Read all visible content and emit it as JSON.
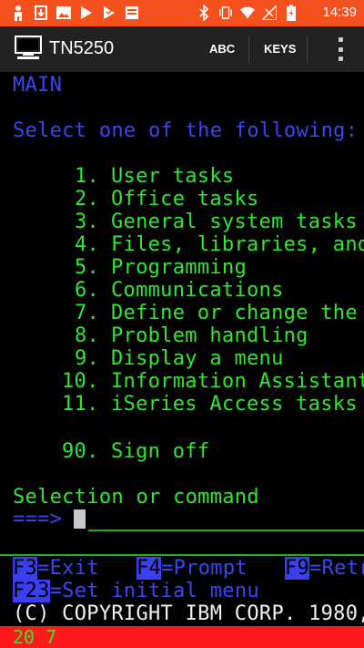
{
  "statusbar": {
    "time": "14:39",
    "notification_icons": [
      "person-icon",
      "download-icon",
      "image-icon",
      "play-store-icon",
      "play-store-icon",
      "news-icon"
    ],
    "system_icons": [
      "bluetooth-icon",
      "vibrate-icon",
      "wifi-icon",
      "no-signal-icon",
      "battery-charging-icon"
    ],
    "color": "#f4511e"
  },
  "appbar": {
    "title": "TN5250",
    "abc_label": "ABC",
    "keys_label": "KEYS",
    "more_icon": "more-vert-icon"
  },
  "terminal": {
    "screen_title": "MAIN",
    "prompt": "Select one of the following:",
    "menu_items": [
      {
        "num": "1.",
        "label": "User tasks"
      },
      {
        "num": "2.",
        "label": "Office tasks"
      },
      {
        "num": "3.",
        "label": "General system tasks"
      },
      {
        "num": "4.",
        "label": "Files, libraries, and"
      },
      {
        "num": "5.",
        "label": "Programming"
      },
      {
        "num": "6.",
        "label": "Communications"
      },
      {
        "num": "7.",
        "label": "Define or change the"
      },
      {
        "num": "8.",
        "label": "Problem handling"
      },
      {
        "num": "9.",
        "label": "Display a menu"
      },
      {
        "num": "10.",
        "label": "Information Assistant"
      },
      {
        "num": "11.",
        "label": "iSeries Access tasks"
      }
    ],
    "sign_off": {
      "num": "90.",
      "label": "Sign off"
    },
    "selection_label": "Selection or command",
    "input_arrow": "===>",
    "fkeys_row1": [
      {
        "key": "F3",
        "label": "=Exit"
      },
      {
        "key": "F4",
        "label": "=Prompt"
      },
      {
        "key": "F9",
        "label": "=Retr"
      }
    ],
    "fkeys_row2": [
      {
        "key": "F23",
        "label": "=Set initial menu"
      }
    ],
    "copyright": "(C) COPYRIGHT IBM CORP. 1980,",
    "cursor_position": "20 7"
  },
  "colors": {
    "blue": "#3b46f2",
    "green": "#2fe82f",
    "white": "#f2f2f2",
    "oia_bar": "#ff1a1a"
  }
}
